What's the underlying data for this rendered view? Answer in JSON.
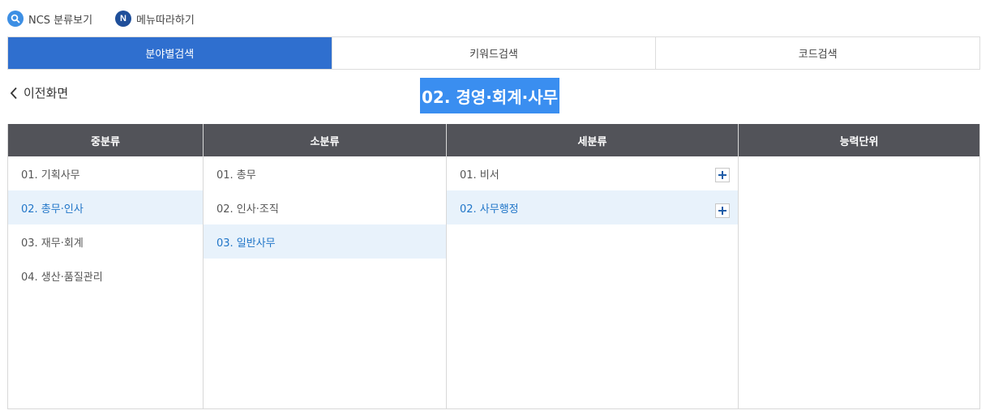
{
  "top_links": {
    "ncs_label": "NCS 분류보기",
    "menu_label": "메뉴따라하기",
    "menu_icon_letter": "N"
  },
  "tabs": [
    {
      "label": "분야별검색",
      "active": true
    },
    {
      "label": "키워드검색",
      "active": false
    },
    {
      "label": "코드검색",
      "active": false
    }
  ],
  "back_label": "이전화면",
  "title": "02. 경영·회계·사무",
  "columns": {
    "headers": [
      "중분류",
      "소분류",
      "세분류",
      "능력단위"
    ],
    "middle": [
      {
        "label": "01. 기획사무",
        "selected": false
      },
      {
        "label": "02. 총무·인사",
        "selected": true
      },
      {
        "label": "03. 재무·회계",
        "selected": false
      },
      {
        "label": "04. 생산·품질관리",
        "selected": false
      }
    ],
    "small": [
      {
        "label": "01. 총무",
        "selected": false
      },
      {
        "label": "02. 인사·조직",
        "selected": false
      },
      {
        "label": "03. 일반사무",
        "selected": true
      }
    ],
    "detail": [
      {
        "label": "01. 비서",
        "selected": false
      },
      {
        "label": "02. 사무행정",
        "selected": true
      }
    ],
    "units": []
  },
  "colors": {
    "tab_active": "#2f6fcf",
    "title_bg": "#3a8ef0",
    "header_bg": "#525359",
    "selected_bg": "#e8f2fb",
    "selected_text": "#2176c8"
  }
}
